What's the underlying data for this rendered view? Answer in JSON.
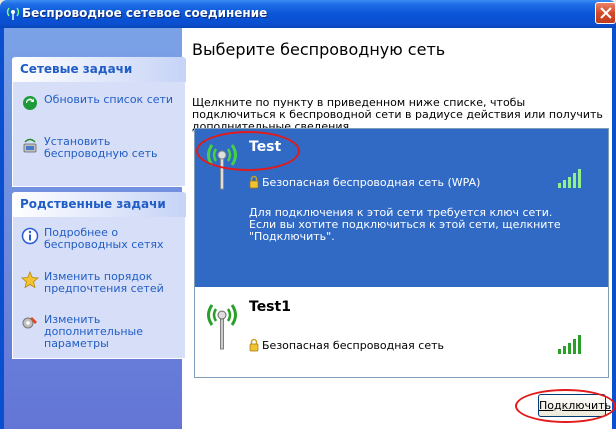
{
  "window": {
    "title": "Беспроводное сетевое соединение",
    "close_label": "X"
  },
  "sidebar": {
    "groups": [
      {
        "header": "Сетевые задачи",
        "items": [
          {
            "label": "Обновить список сети",
            "icon": "refresh-icon"
          },
          {
            "label": "Установить беспроводную сеть",
            "icon": "setup-network-icon"
          }
        ]
      },
      {
        "header": "Родственные задачи",
        "items": [
          {
            "label": "Подробнее о беспроводных сетях",
            "icon": "info-icon"
          },
          {
            "label": "Изменить порядок предпочтения сетей",
            "icon": "star-icon"
          },
          {
            "label": "Изменить дополнительные параметры",
            "icon": "settings-icon"
          }
        ]
      }
    ]
  },
  "main": {
    "heading": "Выберите беспроводную сеть",
    "instruction": "Щелкните по пункту в приведенном ниже списке, чтобы подключиться к беспроводной сети в радиусе действия или получить дополнительные сведения.",
    "networks": [
      {
        "name": "Test",
        "security": "Безопасная беспроводная сеть (WPA)",
        "description": "Для подключения к этой сети требуется ключ сети. Если вы хотите подключиться к этой сети, щелкните \"Подключить\".",
        "selected": true,
        "signal_bars": 5
      },
      {
        "name": "Test1",
        "security": "Безопасная беспроводная сеть",
        "selected": false,
        "signal_bars": 5
      }
    ],
    "connect_button": "Подключить"
  },
  "colors": {
    "titlebar": "#0a55d8",
    "selection": "#316ac5",
    "link": "#215dc6",
    "annotation": "#e21a1a",
    "signal_green": "#2aa02a"
  }
}
